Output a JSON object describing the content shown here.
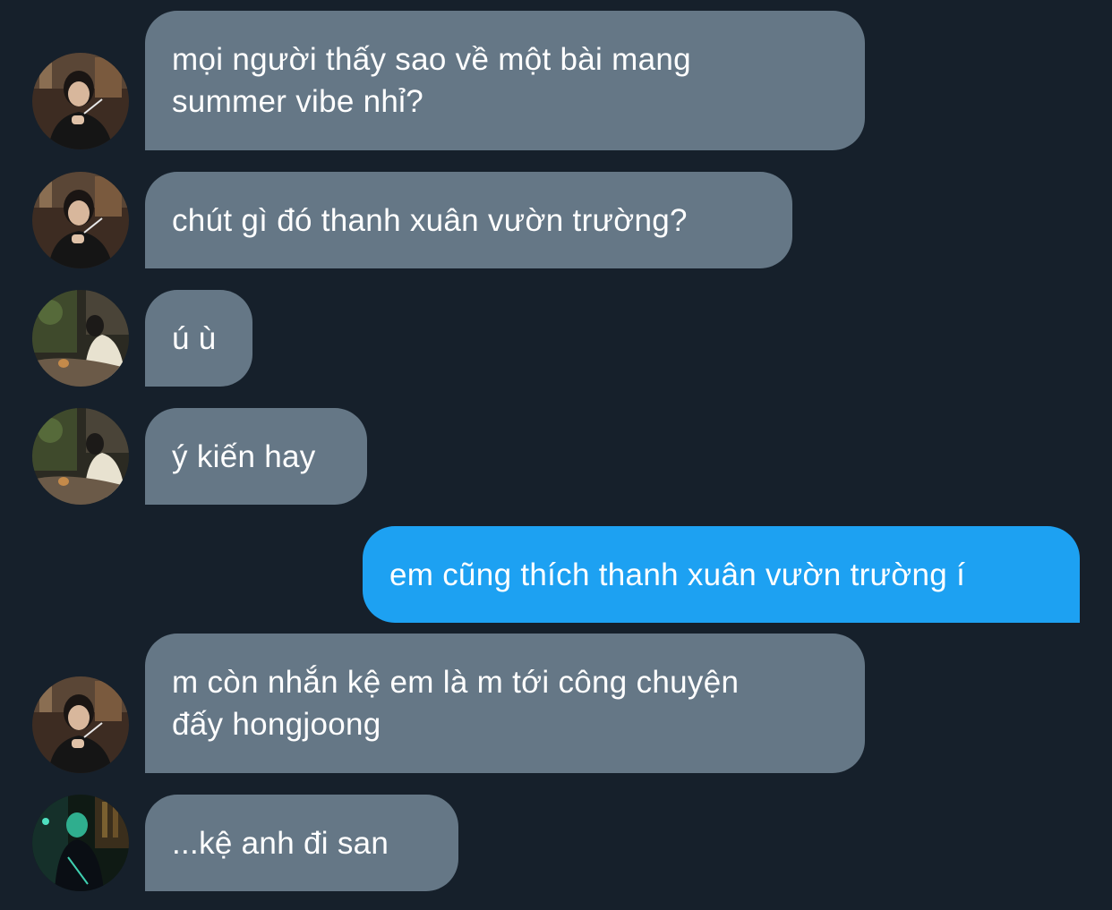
{
  "conversation": {
    "messages": [
      {
        "direction": "incoming",
        "avatar": "avatar-person-black-shirt",
        "text": "mọi người thấy sao về một bài mang\nsummer vibe nhỉ?"
      },
      {
        "direction": "incoming",
        "avatar": "avatar-person-black-shirt",
        "text": "chút gì đó thanh xuân vườn trường?"
      },
      {
        "direction": "incoming",
        "avatar": "avatar-person-with-cat",
        "text": "ú ù"
      },
      {
        "direction": "incoming",
        "avatar": "avatar-person-with-cat",
        "text": "ý kiến hay"
      },
      {
        "direction": "outgoing",
        "avatar": null,
        "text": "em cũng thích thanh xuân vườn trường í"
      },
      {
        "direction": "incoming",
        "avatar": "avatar-person-black-shirt",
        "text": "m còn nhắn kệ em là m tới công chuyện\nđấy hongjoong"
      },
      {
        "direction": "incoming",
        "avatar": "avatar-person-neon-green",
        "text": "...kệ anh đi san"
      }
    ]
  },
  "colors": {
    "background": "#16202b",
    "incoming_bubble": "#657786",
    "outgoing_bubble": "#1da1f2",
    "text": "#ffffff"
  }
}
